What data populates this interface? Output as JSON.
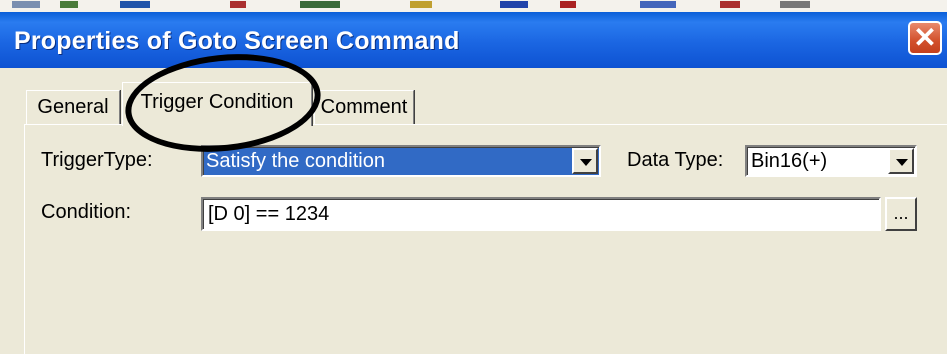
{
  "dialog": {
    "title": "Properties of Goto Screen Command",
    "close_glyph": "✕"
  },
  "tabs": [
    {
      "label": "General",
      "active": false
    },
    {
      "label": "Trigger Condition",
      "active": true
    },
    {
      "label": "Comment",
      "active": false
    }
  ],
  "trigger": {
    "type_label": "TriggerType:",
    "type_value": "Satisfy the condition",
    "data_type_label": "Data Type:",
    "data_type_value": "Bin16(+)",
    "condition_label": "Condition:",
    "condition_value": "[D 0] == 1234",
    "browse_label": "..."
  },
  "icons": {
    "combo_arrow": "chevron-down-icon",
    "close": "close-icon"
  },
  "colors": {
    "titlebar": "#1b66e2",
    "selection": "#316ac5",
    "face": "#ece9d8",
    "close": "#d2502b"
  }
}
